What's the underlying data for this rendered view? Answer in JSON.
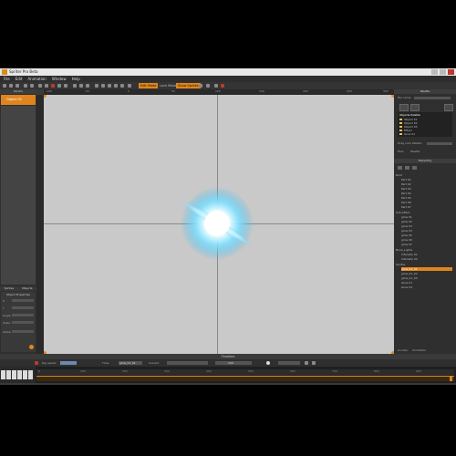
{
  "window": {
    "title": "Spriter Pro Beta"
  },
  "menu": [
    "File",
    "Edit",
    "Animation",
    "Window",
    "Help"
  ],
  "toolbar": {
    "buttons": [
      "Edit Mode",
      "Lock Mode",
      "Show Sprites"
    ]
  },
  "ruler_top_labels": [
    "-100",
    "-50",
    "0",
    "50",
    "100",
    "150",
    "200",
    "250",
    "300"
  ],
  "left_panel": {
    "header": "Palette",
    "selected_item": "Object 01",
    "tabs": [
      "Sprites",
      "Objects"
    ],
    "props_header": "Object Properties",
    "props": [
      "X",
      "Y",
      "Angle",
      "Scale",
      "Alpha"
    ]
  },
  "right_panel": {
    "header_top": "Palette",
    "file_label": "File name",
    "color_header": "Objects Palette",
    "palette_items": [
      "Object 01",
      "Object 02",
      "Object 03",
      "Effect",
      "Glow 01"
    ],
    "fields_label": "Drag onto Palette",
    "tabs": [
      "Files",
      "Palette"
    ],
    "hierarchy_header": "Hierarchy",
    "tree": [
      {
        "label": "Root",
        "indent": 0
      },
      {
        "label": "Part 01",
        "indent": 1
      },
      {
        "label": "Part 02",
        "indent": 1
      },
      {
        "label": "Part 03",
        "indent": 1
      },
      {
        "label": "Part 04",
        "indent": 1
      },
      {
        "label": "Part 05",
        "indent": 1
      },
      {
        "label": "Part 06",
        "indent": 1
      },
      {
        "label": "Part 07",
        "indent": 1
      },
      {
        "label": "Sub-effect",
        "indent": 0
      },
      {
        "label": "glow 01",
        "indent": 1
      },
      {
        "label": "glow 02",
        "indent": 1
      },
      {
        "label": "glow 03",
        "indent": 1
      },
      {
        "label": "glow 04",
        "indent": 1
      },
      {
        "label": "glow 05",
        "indent": 1
      },
      {
        "label": "glow 06",
        "indent": 1
      },
      {
        "label": "glow 07",
        "indent": 1
      },
      {
        "label": "Bone_Lights",
        "indent": 0
      },
      {
        "label": "Intensity 01",
        "indent": 1
      },
      {
        "label": "Intensity 02",
        "indent": 1
      },
      {
        "label": "Sprites",
        "indent": 0
      },
      {
        "label": "glow_01_01",
        "indent": 1,
        "selected": true
      },
      {
        "label": "glow_01_02",
        "indent": 1
      },
      {
        "label": "glow_01_03",
        "indent": 1
      },
      {
        "label": "Glow 01",
        "indent": 1
      },
      {
        "label": "Glow 02",
        "indent": 1
      }
    ],
    "bottom_tabs": [
      "Z-order",
      "Animation"
    ]
  },
  "bottom": {
    "title": "Timeline",
    "speed_label": "Key speed",
    "time_label": "Time",
    "time_value": "glow_01_01",
    "current_label": "Current",
    "frame_value": "100"
  },
  "timeline_ticks": [
    "0",
    "100",
    "200",
    "300",
    "400",
    "500",
    "600",
    "700",
    "800",
    "900"
  ],
  "colors": {
    "accent": "#e0851e",
    "canvas": "#c9c9c9",
    "glow": "#5fd0ff"
  }
}
